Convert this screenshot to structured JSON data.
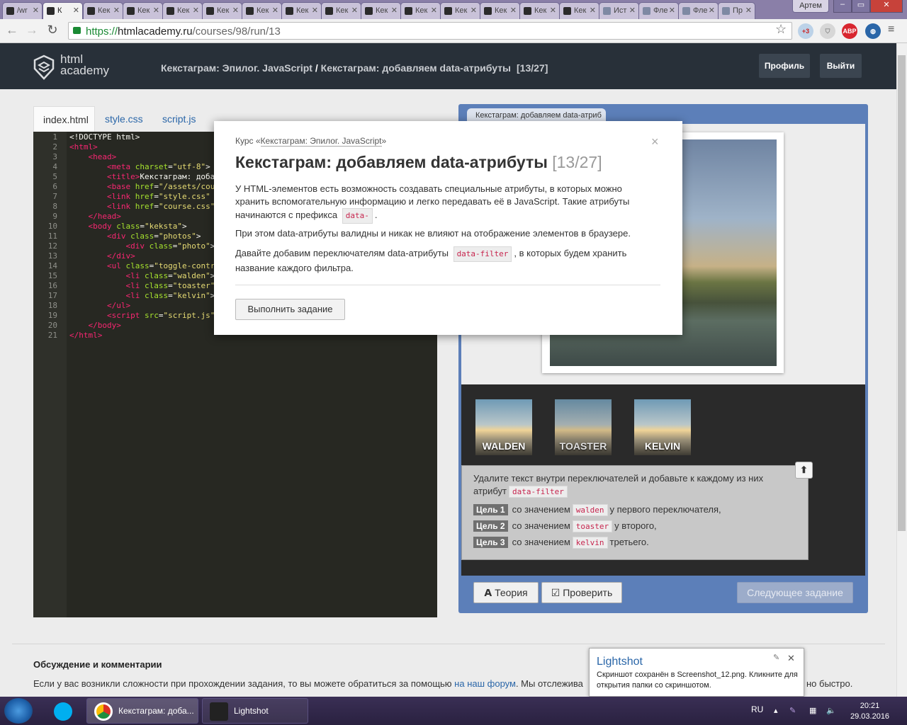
{
  "browser": {
    "tabs": [
      {
        "label": "/wr"
      },
      {
        "label": "К"
      },
      {
        "label": "Кек"
      },
      {
        "label": "Кек"
      },
      {
        "label": "Кек"
      },
      {
        "label": "Кек"
      },
      {
        "label": "Кек"
      },
      {
        "label": "Кек"
      },
      {
        "label": "Кек"
      },
      {
        "label": "Кек"
      },
      {
        "label": "Кек"
      },
      {
        "label": "Кек"
      },
      {
        "label": "Кек"
      },
      {
        "label": "Кек"
      },
      {
        "label": "Кек"
      },
      {
        "label": "Ист"
      },
      {
        "label": "Фле"
      },
      {
        "label": "Фле"
      },
      {
        "label": "Пр"
      }
    ],
    "window_user": "Артем",
    "url_scheme": "https://",
    "url_host": "htmlacademy.ru",
    "url_path": "/courses/98/run/13",
    "abp_label": "ABP",
    "ext_badge": "+3"
  },
  "header": {
    "logo_line1": "html",
    "logo_line2": "academy",
    "breadcrumb_course": "Кекстаграм: Эпилог. JavaScript",
    "breadcrumb_sep": " / ",
    "breadcrumb_task": "Кекстаграм: добавляем data-атрибуты",
    "progress": "[13/27]",
    "profile_button": "Профиль",
    "logout_button": "Выйти"
  },
  "editor": {
    "tabs": [
      "index.html",
      "style.css",
      "script.js"
    ],
    "line_numbers": [
      "1",
      "2",
      "3",
      "4",
      "5",
      "6",
      "7",
      "8",
      "9",
      "10",
      "11",
      "12",
      "13",
      "14",
      "15",
      "16",
      "17",
      "18",
      "19",
      "20",
      "21"
    ]
  },
  "preview": {
    "tab_title": "Кекстаграм: добавляем data-атриб",
    "filters": [
      "WALDEN",
      "TOASTER",
      "KELVIN"
    ],
    "task_intro": "Удалите текст внутри переключателей и добавьте к каждому из них",
    "task_attr_word": "атрибут",
    "task_attr": "data-filter",
    "goals": [
      {
        "label": "Цель 1",
        "pre": "со значением",
        "value": "walden",
        "post": "у первого переключателя,"
      },
      {
        "label": "Цель 2",
        "pre": "со значением",
        "value": "toaster",
        "post": "у второго,"
      },
      {
        "label": "Цель 3",
        "pre": "со значением",
        "value": "kelvin",
        "post": "третьего."
      }
    ],
    "theory_button": "Теория",
    "check_button": "Проверить",
    "next_button": "Следующее задание"
  },
  "modal": {
    "course_prefix": "Курс «",
    "course_name": "Кекстаграм: Эпилог. JavaScript",
    "course_suffix": "»",
    "title": "Кекстаграм: добавляем data-атрибуты",
    "title_num": "[13/27]",
    "close": "×",
    "p1": "У HTML-элементов есть возможность создавать специальные атрибуты, в которых можно хранить вспомогательную информацию и легко передавать её в JavaScript. Такие атрибуты начинаются с префикса",
    "p1_code": "data-",
    "p1_end": ".",
    "p2": "При этом data-атрибуты валидны и никак не влияют на отображение элементов в браузере.",
    "p3_start": "Давайте добавим переключателям data-атрибуты",
    "p3_code": "data-filter",
    "p3_end": ", в которых будем хранить название каждого фильтра.",
    "button": "Выполнить задание"
  },
  "footer": {
    "title": "Обсуждение и комментарии",
    "text_start": "Если у вас возникли сложности при прохождении задания, то вы можете обратиться за помощью",
    "forum_link": "на наш форум",
    "text_mid": ". Мы отслежива",
    "text_tail": "но быстро."
  },
  "lightshot": {
    "title": "Lightshot",
    "text": "Скриншот сохранён в Screenshot_12.png. Кликните для открытия папки со скриншотом."
  },
  "taskbar": {
    "chrome_window": "Кекстаграм: доба...",
    "lightshot_window": "Lightshot",
    "lang": "RU",
    "time": "20:21",
    "date": "29.03.2016"
  },
  "colors": {
    "header_bg": "#283039",
    "preview_frame": "#5c7fb9",
    "code_bg": "#272822",
    "link": "#2a66a8",
    "code_chip": "#c7254e"
  }
}
